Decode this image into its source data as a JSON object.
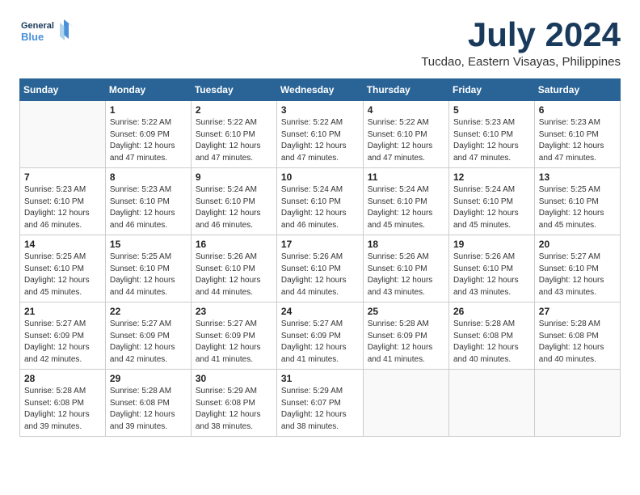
{
  "logo": {
    "line1": "General",
    "line2": "Blue"
  },
  "title": "July 2024",
  "subtitle": "Tucdao, Eastern Visayas, Philippines",
  "weekdays": [
    "Sunday",
    "Monday",
    "Tuesday",
    "Wednesday",
    "Thursday",
    "Friday",
    "Saturday"
  ],
  "weeks": [
    [
      {
        "day": "",
        "info": ""
      },
      {
        "day": "1",
        "info": "Sunrise: 5:22 AM\nSunset: 6:09 PM\nDaylight: 12 hours\nand 47 minutes."
      },
      {
        "day": "2",
        "info": "Sunrise: 5:22 AM\nSunset: 6:10 PM\nDaylight: 12 hours\nand 47 minutes."
      },
      {
        "day": "3",
        "info": "Sunrise: 5:22 AM\nSunset: 6:10 PM\nDaylight: 12 hours\nand 47 minutes."
      },
      {
        "day": "4",
        "info": "Sunrise: 5:22 AM\nSunset: 6:10 PM\nDaylight: 12 hours\nand 47 minutes."
      },
      {
        "day": "5",
        "info": "Sunrise: 5:23 AM\nSunset: 6:10 PM\nDaylight: 12 hours\nand 47 minutes."
      },
      {
        "day": "6",
        "info": "Sunrise: 5:23 AM\nSunset: 6:10 PM\nDaylight: 12 hours\nand 47 minutes."
      }
    ],
    [
      {
        "day": "7",
        "info": "Sunrise: 5:23 AM\nSunset: 6:10 PM\nDaylight: 12 hours\nand 46 minutes."
      },
      {
        "day": "8",
        "info": "Sunrise: 5:23 AM\nSunset: 6:10 PM\nDaylight: 12 hours\nand 46 minutes."
      },
      {
        "day": "9",
        "info": "Sunrise: 5:24 AM\nSunset: 6:10 PM\nDaylight: 12 hours\nand 46 minutes."
      },
      {
        "day": "10",
        "info": "Sunrise: 5:24 AM\nSunset: 6:10 PM\nDaylight: 12 hours\nand 46 minutes."
      },
      {
        "day": "11",
        "info": "Sunrise: 5:24 AM\nSunset: 6:10 PM\nDaylight: 12 hours\nand 45 minutes."
      },
      {
        "day": "12",
        "info": "Sunrise: 5:24 AM\nSunset: 6:10 PM\nDaylight: 12 hours\nand 45 minutes."
      },
      {
        "day": "13",
        "info": "Sunrise: 5:25 AM\nSunset: 6:10 PM\nDaylight: 12 hours\nand 45 minutes."
      }
    ],
    [
      {
        "day": "14",
        "info": "Sunrise: 5:25 AM\nSunset: 6:10 PM\nDaylight: 12 hours\nand 45 minutes."
      },
      {
        "day": "15",
        "info": "Sunrise: 5:25 AM\nSunset: 6:10 PM\nDaylight: 12 hours\nand 44 minutes."
      },
      {
        "day": "16",
        "info": "Sunrise: 5:26 AM\nSunset: 6:10 PM\nDaylight: 12 hours\nand 44 minutes."
      },
      {
        "day": "17",
        "info": "Sunrise: 5:26 AM\nSunset: 6:10 PM\nDaylight: 12 hours\nand 44 minutes."
      },
      {
        "day": "18",
        "info": "Sunrise: 5:26 AM\nSunset: 6:10 PM\nDaylight: 12 hours\nand 43 minutes."
      },
      {
        "day": "19",
        "info": "Sunrise: 5:26 AM\nSunset: 6:10 PM\nDaylight: 12 hours\nand 43 minutes."
      },
      {
        "day": "20",
        "info": "Sunrise: 5:27 AM\nSunset: 6:10 PM\nDaylight: 12 hours\nand 43 minutes."
      }
    ],
    [
      {
        "day": "21",
        "info": "Sunrise: 5:27 AM\nSunset: 6:09 PM\nDaylight: 12 hours\nand 42 minutes."
      },
      {
        "day": "22",
        "info": "Sunrise: 5:27 AM\nSunset: 6:09 PM\nDaylight: 12 hours\nand 42 minutes."
      },
      {
        "day": "23",
        "info": "Sunrise: 5:27 AM\nSunset: 6:09 PM\nDaylight: 12 hours\nand 41 minutes."
      },
      {
        "day": "24",
        "info": "Sunrise: 5:27 AM\nSunset: 6:09 PM\nDaylight: 12 hours\nand 41 minutes."
      },
      {
        "day": "25",
        "info": "Sunrise: 5:28 AM\nSunset: 6:09 PM\nDaylight: 12 hours\nand 41 minutes."
      },
      {
        "day": "26",
        "info": "Sunrise: 5:28 AM\nSunset: 6:08 PM\nDaylight: 12 hours\nand 40 minutes."
      },
      {
        "day": "27",
        "info": "Sunrise: 5:28 AM\nSunset: 6:08 PM\nDaylight: 12 hours\nand 40 minutes."
      }
    ],
    [
      {
        "day": "28",
        "info": "Sunrise: 5:28 AM\nSunset: 6:08 PM\nDaylight: 12 hours\nand 39 minutes."
      },
      {
        "day": "29",
        "info": "Sunrise: 5:28 AM\nSunset: 6:08 PM\nDaylight: 12 hours\nand 39 minutes."
      },
      {
        "day": "30",
        "info": "Sunrise: 5:29 AM\nSunset: 6:08 PM\nDaylight: 12 hours\nand 38 minutes."
      },
      {
        "day": "31",
        "info": "Sunrise: 5:29 AM\nSunset: 6:07 PM\nDaylight: 12 hours\nand 38 minutes."
      },
      {
        "day": "",
        "info": ""
      },
      {
        "day": "",
        "info": ""
      },
      {
        "day": "",
        "info": ""
      }
    ]
  ]
}
